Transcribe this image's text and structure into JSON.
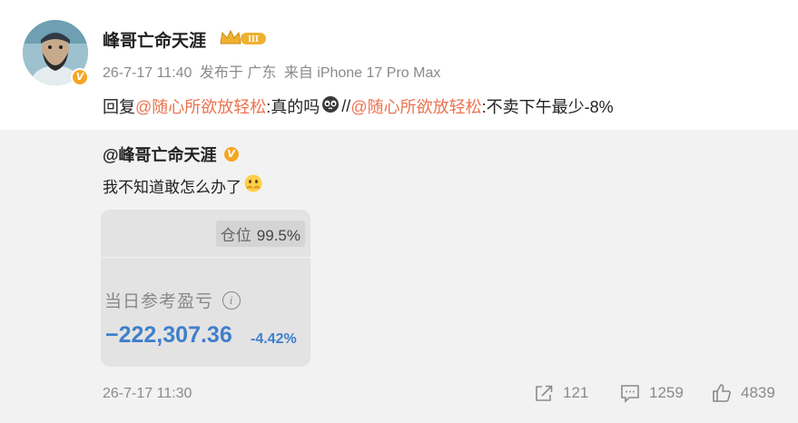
{
  "post": {
    "username": "峰哥亡命天涯",
    "rank_badge": "III",
    "verified_badge": "V",
    "timestamp": "26-7-17 11:40",
    "location": "发布于 广东",
    "device": "来自 iPhone 17 Pro Max",
    "reply_prefix": "回复",
    "mention_1": "@随心所欲放轻松",
    "reply_body": ":真的吗",
    "separator": "//",
    "mention_2": "@随心所欲放轻松",
    "quoted_body": ":不卖下午最少-8%"
  },
  "repost": {
    "username": "@峰哥亡命天涯",
    "text": "我不知道敢怎么办了",
    "card": {
      "position_label": "仓位",
      "position_value": "99.5%",
      "pnl_label": "当日参考盈亏",
      "pnl_value": "−222,307.36",
      "pnl_percent": "-4.42%"
    },
    "timestamp": "26-7-17 11:30",
    "actions": {
      "share_count": "121",
      "comment_count": "1259",
      "like_count": "4839"
    }
  },
  "colors": {
    "mention": "#eb7350",
    "loss_blue": "#3f7fcb",
    "verified_gold": "#f5a623",
    "repost_bg": "#f2f2f2",
    "meta_gray": "#8a8a8a"
  },
  "icons": {
    "verified": "verified-v-icon",
    "rank": "crown-rank-icon",
    "reply_emoji": "panda-emoji-icon",
    "text_emoji": "clasped-hands-face-emoji-icon",
    "info": "info-icon",
    "share": "share-icon",
    "comment": "comment-icon",
    "like": "thumbs-up-icon"
  }
}
